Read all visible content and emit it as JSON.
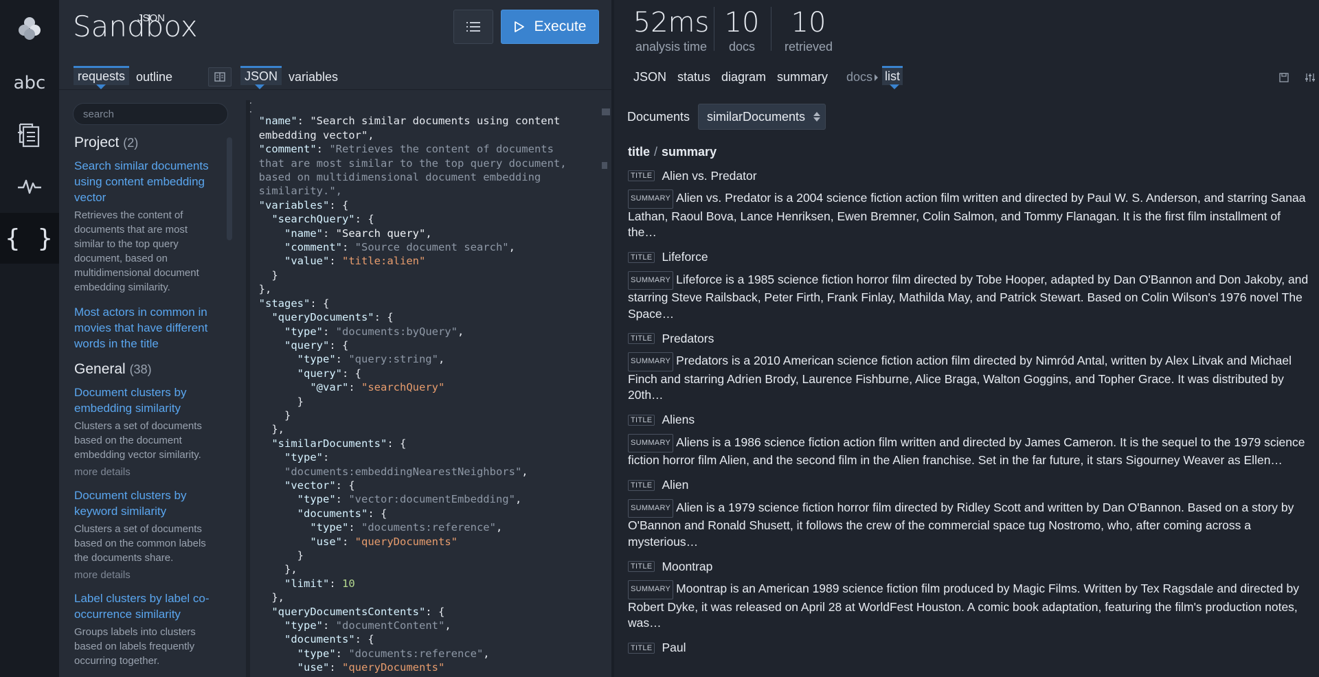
{
  "app": {
    "brand_sandbox": "Sandbox",
    "brand_json": "JSON"
  },
  "rail": {
    "items": [
      "logo-icon",
      "abc",
      "document-copy-icon",
      "pulse-icon",
      "braces-icon"
    ],
    "abc_label": "abc",
    "braces_label": "{ }"
  },
  "toolbar": {
    "execute_label": "Execute",
    "accent_color": "#3a83cf"
  },
  "left_tabs": {
    "requests": "requests",
    "outline": "outline",
    "json": "JSON",
    "variables": "variables"
  },
  "requests": {
    "search_placeholder": "search",
    "groups": [
      {
        "name": "Project",
        "count": "(2)",
        "items": [
          {
            "title": "Search similar documents using content embedding vector",
            "description": "Retrieves the content of documents that are most similar to the top query document, based on multidimensional document embedding similarity.",
            "more": ""
          },
          {
            "title": "Most actors in common in movies that have different words in the title",
            "description": "",
            "more": ""
          }
        ]
      },
      {
        "name": "General",
        "count": "(38)",
        "items": [
          {
            "title": "Document clusters by embedding similarity",
            "description": "Clusters a set of documents based on the document embedding vector similarity.",
            "more": "more details"
          },
          {
            "title": "Document clusters by keyword similarity",
            "description": "Clusters a set of documents based on the common labels the documents share.",
            "more": "more details"
          },
          {
            "title": "Label clusters by label co-occurrence similarity",
            "description": "Groups labels into clusters based on labels frequently occurring together.",
            "more": ""
          }
        ]
      }
    ]
  },
  "editor": {
    "lines": [
      "{",
      "  \"name\": \"Search similar documents using content",
      "  embedding vector\",",
      "  \"comment\": \"Retrieves the content of documents",
      "  that are most similar to the top query document,",
      "  based on multidimensional document embedding",
      "  similarity.\",",
      "  \"variables\": {",
      "    \"searchQuery\": {",
      "      \"name\": \"Search query\",",
      "      \"comment\": \"Source document search\",",
      "      \"value\": \"title:alien\"",
      "    }",
      "  },",
      "  \"stages\": {",
      "    \"queryDocuments\": {",
      "      \"type\": \"documents:byQuery\",",
      "      \"query\": {",
      "        \"type\": \"query:string\",",
      "        \"query\": {",
      "          \"@var\": \"searchQuery\"",
      "        }",
      "      }",
      "    },",
      "    \"similarDocuments\": {",
      "      \"type\":",
      "      \"documents:embeddingNearestNeighbors\",",
      "      \"vector\": {",
      "        \"type\": \"vector:documentEmbedding\",",
      "        \"documents\": {",
      "          \"type\": \"documents:reference\",",
      "          \"use\": \"queryDocuments\"",
      "        }",
      "      },",
      "      \"limit\": 10",
      "    },",
      "    \"queryDocumentsContents\": {",
      "      \"type\": \"documentContent\",",
      "      \"documents\": {",
      "        \"type\": \"documents:reference\",",
      "        \"use\": \"queryDocuments\""
    ]
  },
  "stats": [
    {
      "value": "52ms",
      "label": "analysis time"
    },
    {
      "value": "10",
      "label": "docs"
    },
    {
      "value": "10",
      "label": "retrieved"
    }
  ],
  "right_tabs": {
    "json": "JSON",
    "status": "status",
    "diagram": "diagram",
    "summary": "summary",
    "docs": "docs",
    "list": "list"
  },
  "documents": {
    "label": "Documents",
    "selected": "similarDocuments",
    "header_title": "title",
    "header_sep": "/",
    "header_summary": "summary",
    "title_pill": "TITLE",
    "summary_pill": "SUMMARY",
    "items": [
      {
        "title": "Alien vs. Predator",
        "summary": "Alien vs. Predator is a 2004 science fiction action film written and directed by Paul W. S. Anderson, and starring Sanaa Lathan, Raoul Bova, Lance Henriksen, Ewen Bremner, Colin Salmon, and Tommy Flanagan. It is the first film installment of the…"
      },
      {
        "title": "Lifeforce",
        "summary": "Lifeforce is a 1985 science fiction horror film directed by Tobe Hooper, adapted by Dan O'Bannon and Don Jakoby, and starring Steve Railsback, Peter Firth, Frank Finlay, Mathilda May, and Patrick Stewart. Based on Colin Wilson's 1976 novel The Space…"
      },
      {
        "title": "Predators",
        "summary": "Predators is a 2010 American science fiction action film directed by Nimród Antal, written by Alex Litvak and Michael Finch and starring Adrien Brody, Laurence Fishburne, Alice Braga, Walton Goggins, and Topher Grace. It was distributed by 20th…"
      },
      {
        "title": "Aliens",
        "summary": "Aliens is a 1986 science fiction action film written and directed by James Cameron. It is the sequel to the 1979 science fiction horror film Alien, and the second film in the Alien franchise. Set in the far future, it stars Sigourney Weaver as Ellen…"
      },
      {
        "title": "Alien",
        "summary": "Alien is a 1979 science fiction horror film directed by Ridley Scott and written by Dan O'Bannon. Based on a story by O'Bannon and Ronald Shusett, it follows the crew of the commercial space tug Nostromo, who, after coming across a mysterious…"
      },
      {
        "title": "Moontrap",
        "summary": "Moontrap is an American 1989 science fiction film produced by Magic Films. Written by Tex Ragsdale and directed by Robert Dyke, it was released on April 28 at WorldFest Houston. A comic book adaptation, featuring the film's production notes, was…"
      },
      {
        "title": "Paul",
        "summary": ""
      }
    ]
  }
}
